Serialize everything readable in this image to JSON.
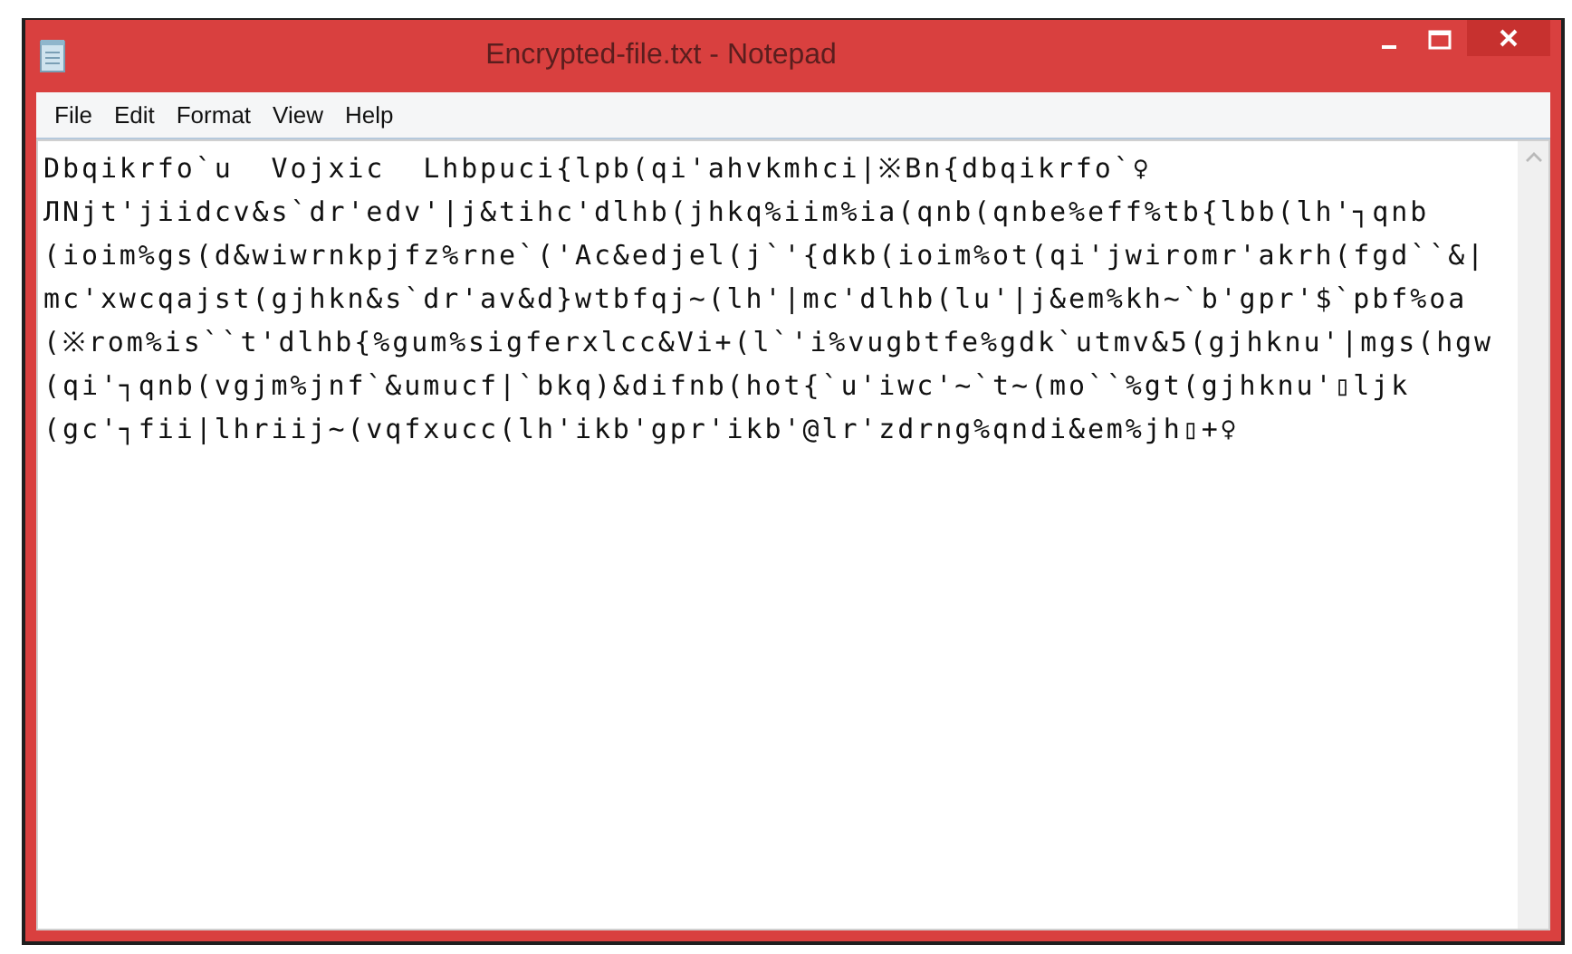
{
  "window": {
    "title": "Encrypted-file.txt - Notepad"
  },
  "menu": [
    "File",
    "Edit",
    "Format",
    "View",
    "Help"
  ],
  "document": {
    "lines": [
      "Dbqikrfo`u  Vojxic  Lhbpuci{lpb(qi'ahvkmhci|※Bn{dbqikrfo`♀",
      "ЛNjt'jiidcv&s`dr'edv'|j&tihc'dlhb(jhkq%iim%ia(qnb(qnbe%eff%tb{lbb(lh'┐qnb",
      "(ioim%gs(d&wiwrnkpjfz%rne`('Ac&edjel(j`'{dkb(ioim%ot(qi'jwiromr'akrh(fgd``&|",
      "mc'xwcqajst(gjhkn&s`dr'av&d}wtbfqj~(lh'|mc'dlhb(lu'|j&em%kh~`b'gpr'$`pbf%oa",
      "(※rom%is``t'dlhb{%gum%sigferxlcc&Vi+(l`'i%vugbtfe%gdk`utmv&5(gjhknu'|mgs(hgw",
      "(qi'┐qnb(vgjm%jnf`&umucf|`bkq)&difnb(hot{`u'iwc'~`t~(mo``%gt(gjhknu'▯ljk",
      "(gc'┐fii|lhriij~(vqfxucc(lh'ikb'gpr'ikb'@lr'zdrng%qndi&em%jh▯+♀"
    ]
  }
}
